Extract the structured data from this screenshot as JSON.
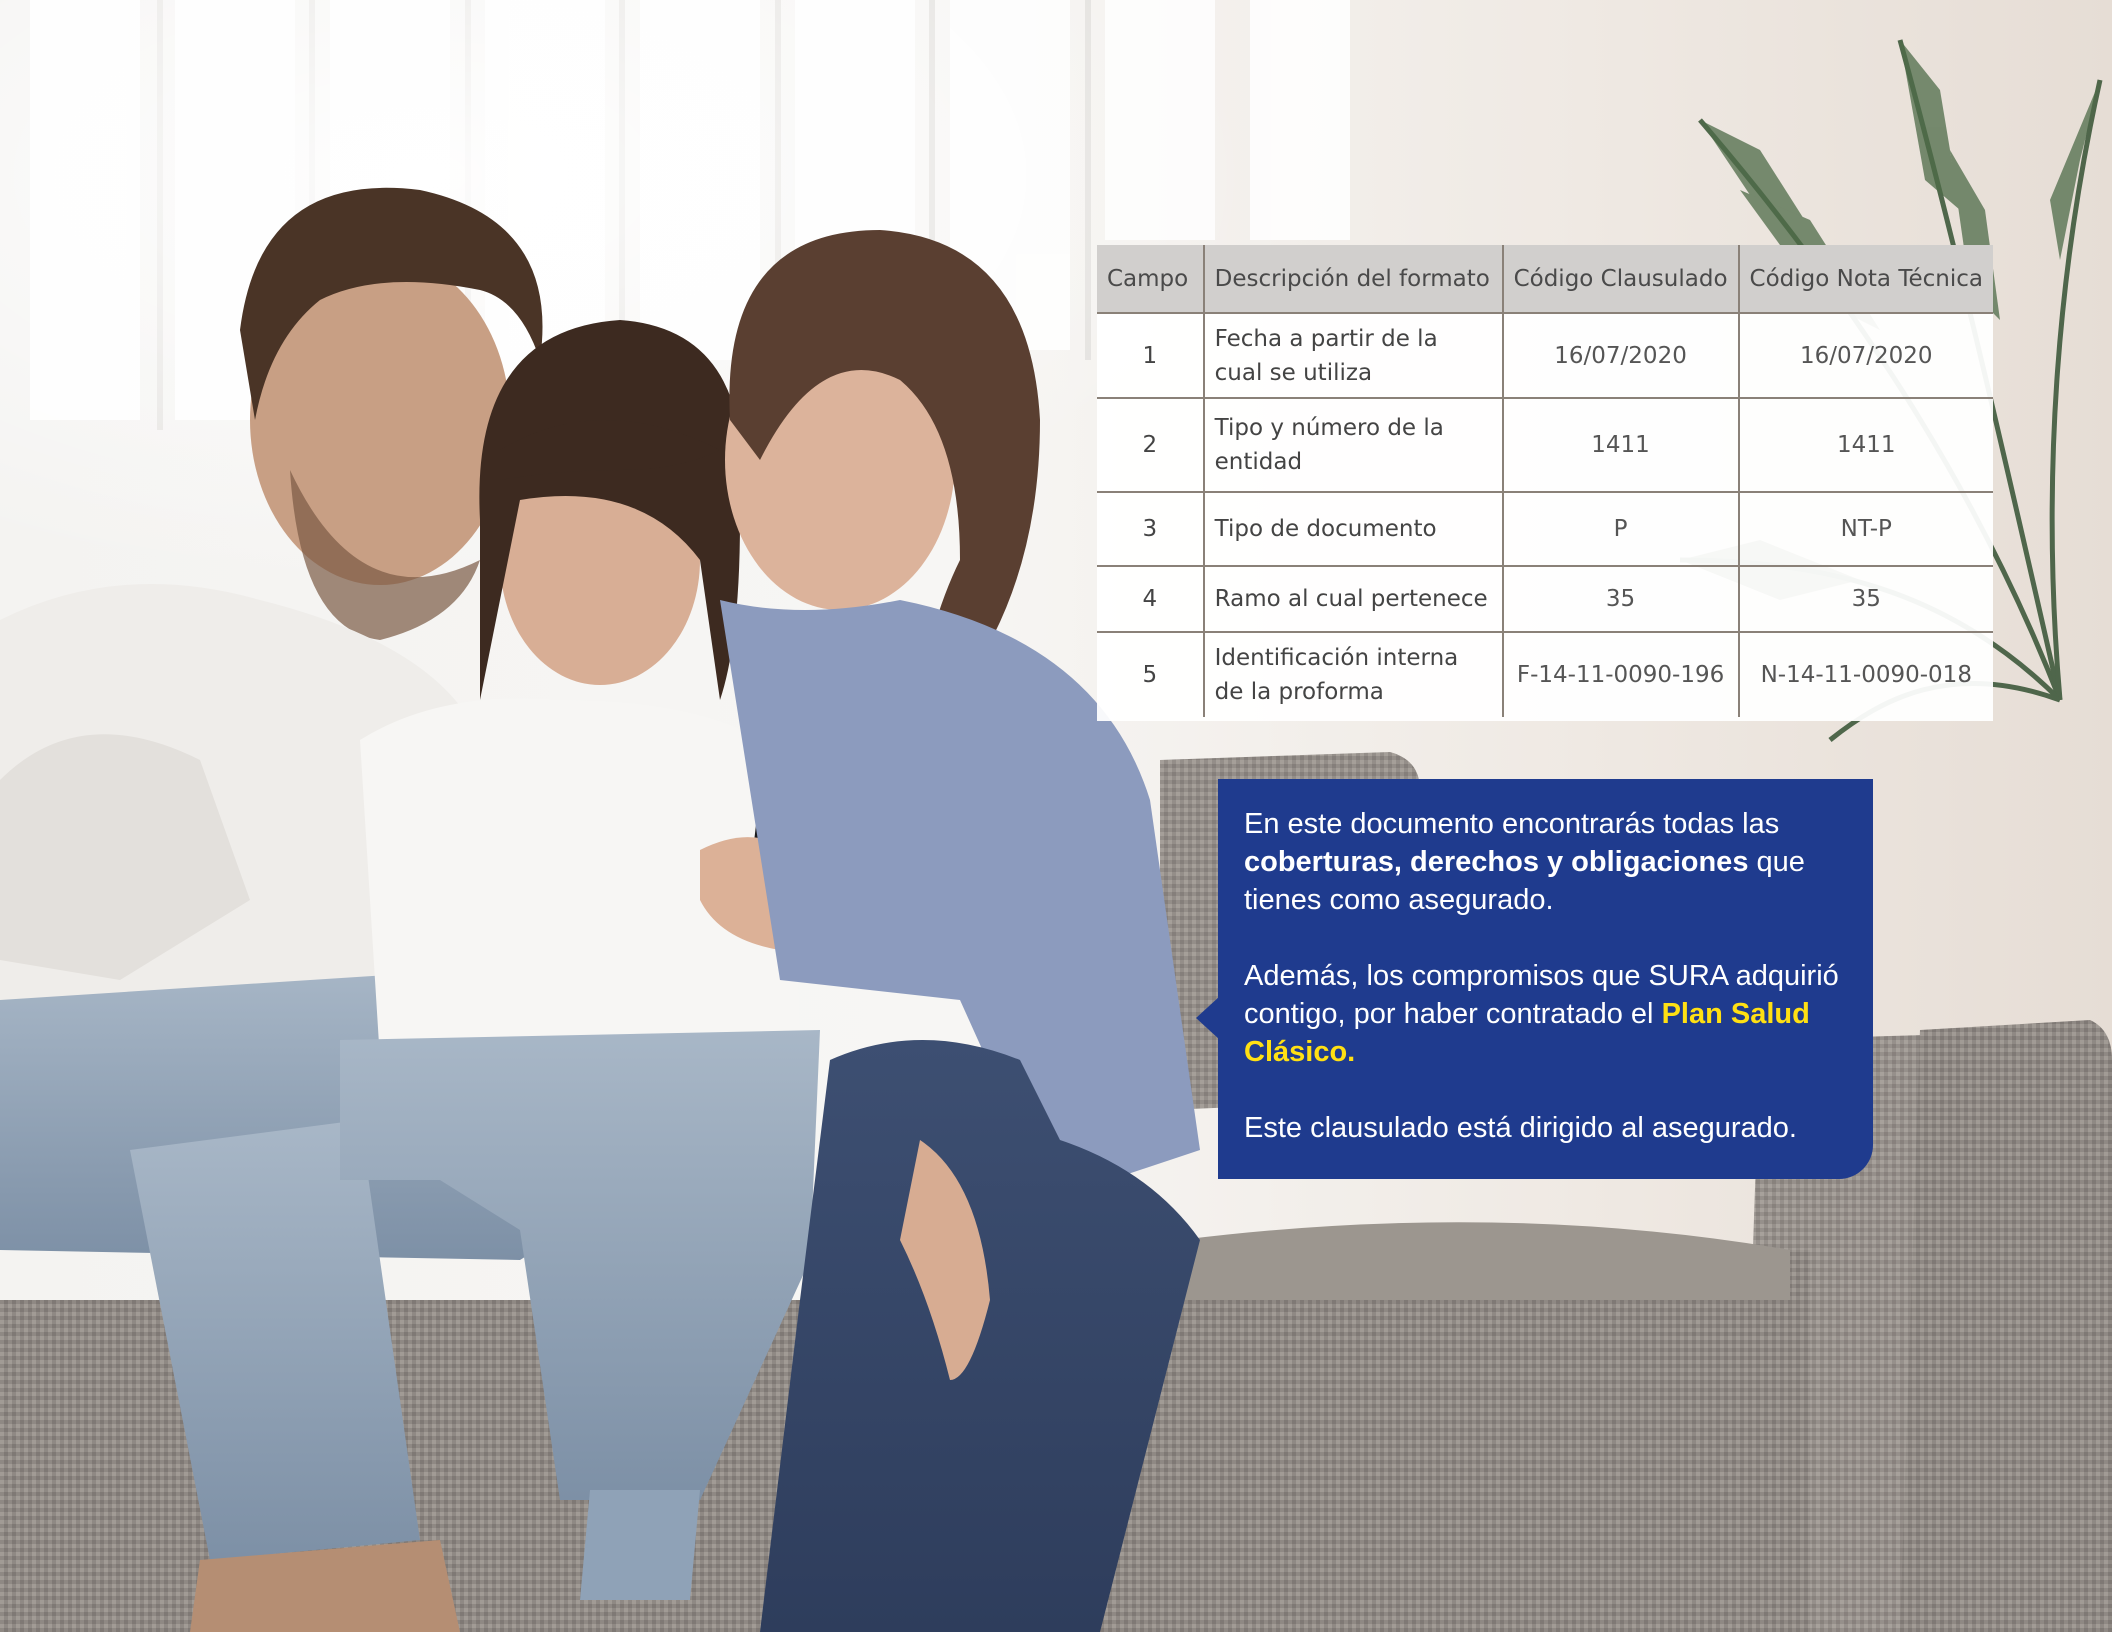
{
  "table": {
    "headers": [
      "Campo",
      "Descripción del formato",
      "Código Clausulado",
      "Código Nota Técnica"
    ],
    "rows": [
      {
        "campo": "1",
        "descripcion": "Fecha a partir de la cual se utiliza",
        "clausulado": "16/07/2020",
        "nota_tecnica": "16/07/2020"
      },
      {
        "campo": "2",
        "descripcion": "Tipo y número de la entidad",
        "clausulado": "1411",
        "nota_tecnica": "1411"
      },
      {
        "campo": "3",
        "descripcion": "Tipo de documento",
        "clausulado": "P",
        "nota_tecnica": "NT-P"
      },
      {
        "campo": "4",
        "descripcion": "Ramo al cual pertenece",
        "clausulado": "35",
        "nota_tecnica": "35"
      },
      {
        "campo": "5",
        "descripcion": "Identificación interna de la proforma",
        "clausulado": "F-14-11-0090-196",
        "nota_tecnica": "N-14-11-0090-018"
      }
    ]
  },
  "callout": {
    "p1_intro": "En este documento encontrarás todas las ",
    "p1_bold": "coberturas, derechos y obligaciones",
    "p1_end": " que tienes como asegurado.",
    "p2_intro": "Además, los compromisos que SURA adquirió contigo, por haber contratado el ",
    "p2_plan": "Plan Salud Clásico.",
    "p3": "Este clausulado está dirigido al asegurado."
  },
  "colors": {
    "callout_bg": "#1f3b8e",
    "plan_highlight": "#ffe013",
    "table_header_bg": "#d1cfcd",
    "table_border": "#8a8178"
  },
  "background_photo": "family-on-sofa-with-phone"
}
